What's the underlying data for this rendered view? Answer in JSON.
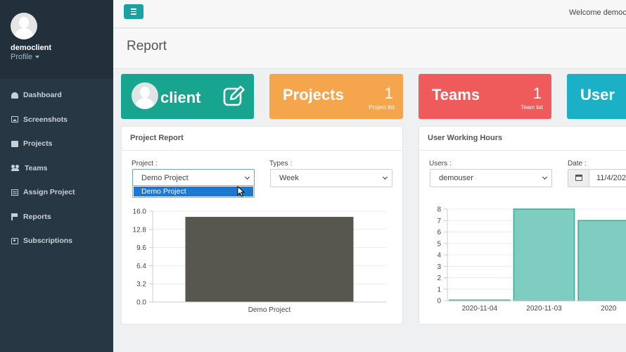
{
  "sidebar": {
    "profile_name": "democlient",
    "profile_link": "Profile",
    "items": [
      {
        "label": "Dashboard",
        "icon": "dashboard-icon"
      },
      {
        "label": "Screenshots",
        "icon": "image-icon"
      },
      {
        "label": "Projects",
        "icon": "edit-icon"
      },
      {
        "label": "Teams",
        "icon": "users-icon"
      },
      {
        "label": "Assign Project",
        "icon": "list-icon"
      },
      {
        "label": "Reports",
        "icon": "flag-icon"
      },
      {
        "label": "Subscriptions",
        "icon": "ticket-icon"
      }
    ]
  },
  "topbar": {
    "welcome": "Welcome democli"
  },
  "page": {
    "title": "Report"
  },
  "tiles": {
    "client": {
      "title": "client",
      "color": "#18a58f"
    },
    "projects": {
      "title": "Projects",
      "count": "1",
      "sub": "Project list",
      "color": "#f5a54c"
    },
    "teams": {
      "title": "Teams",
      "count": "1",
      "sub": "Team list",
      "color": "#ef5a5a"
    },
    "user": {
      "title": "User",
      "color": "#1bb0c6"
    }
  },
  "project_report": {
    "title": "Project Report",
    "project_label": "Project :",
    "project_value": "Demo Project",
    "dropdown_option": "Demo Project",
    "types_label": "Types :",
    "types_value": "Week"
  },
  "user_hours": {
    "title": "User Working Hours",
    "users_label": "Users :",
    "users_value": "demouser",
    "date_label": "Date :",
    "date_value": "11/4/202"
  },
  "chart_data": [
    {
      "type": "bar",
      "categories": [
        "Demo Project"
      ],
      "values": [
        15.0
      ],
      "ylim": [
        0,
        16.0
      ],
      "yticks": [
        "0.0",
        "3.2",
        "6.4",
        "9.6",
        "12.8",
        "16.0"
      ],
      "bar_color": "#58574f",
      "grid": true
    },
    {
      "type": "bar",
      "categories": [
        "2020-11-04",
        "2020-11-03",
        "2020"
      ],
      "values": [
        0.05,
        8,
        7
      ],
      "ylim": [
        0,
        8
      ],
      "yticks": [
        "0",
        "1",
        "2",
        "3",
        "4",
        "5",
        "6",
        "7",
        "8"
      ],
      "bar_color": "#7ecdc0",
      "grid": true
    }
  ]
}
